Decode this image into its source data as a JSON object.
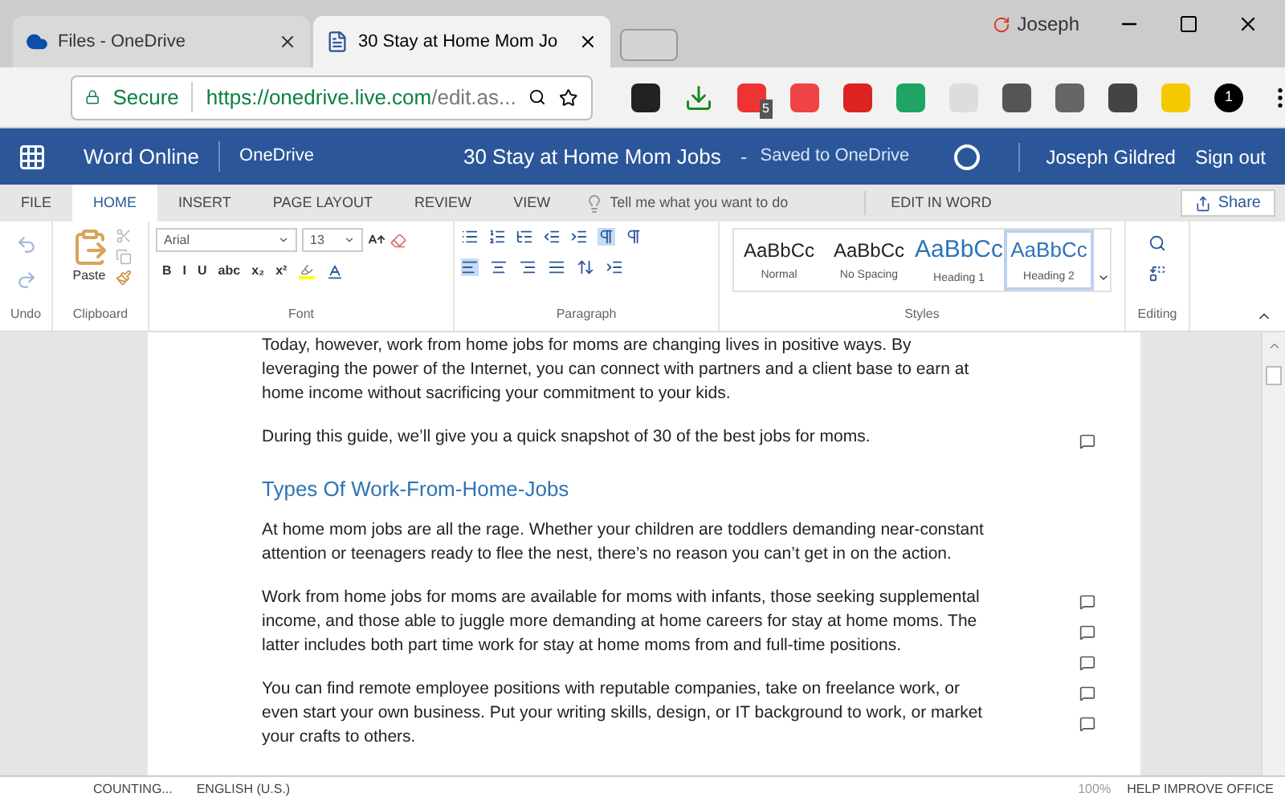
{
  "browser": {
    "profile": "Joseph",
    "tabs": [
      {
        "title": "Files - OneDrive",
        "selected": false
      },
      {
        "title": "30 Stay at Home Mom Jo",
        "selected": true
      }
    ],
    "secure_label": "Secure",
    "url_host": "https://onedrive.live.com",
    "url_path": "/edit.as...",
    "extension_badge": "5",
    "extension_count": "1"
  },
  "app_bar": {
    "app": "Word Online",
    "location": "OneDrive",
    "doc_title": "30 Stay at Home Mom Jobs",
    "separator": "-",
    "save_status": "Saved to OneDrive",
    "user": "Joseph Gildred",
    "sign_out": "Sign out"
  },
  "ribbon_tabs": [
    {
      "label": "FILE",
      "selected": false
    },
    {
      "label": "HOME",
      "selected": true
    },
    {
      "label": "INSERT",
      "selected": false
    },
    {
      "label": "PAGE LAYOUT",
      "selected": false
    },
    {
      "label": "REVIEW",
      "selected": false
    },
    {
      "label": "VIEW",
      "selected": false
    }
  ],
  "tell_me": {
    "placeholder": "Tell me what you want to do"
  },
  "edit_in_word": "EDIT IN WORD",
  "share": "Share",
  "ribbon": {
    "groups": [
      "Undo",
      "Clipboard",
      "Font",
      "Paragraph",
      "Styles",
      "Editing"
    ],
    "paste": "Paste",
    "font": "Arial",
    "size": "13",
    "font_buttons": [
      "B",
      "I",
      "U",
      "abc",
      "x₂",
      "x²"
    ],
    "styles": [
      {
        "sample": "AaBbCc",
        "name": "Normal",
        "kind": "normal",
        "selected": false
      },
      {
        "sample": "AaBbCc",
        "name": "No Spacing",
        "kind": "normal",
        "selected": false
      },
      {
        "sample": "AaBbCc",
        "name": "Heading 1",
        "kind": "heading1",
        "selected": false
      },
      {
        "sample": "AaBbCc",
        "name": "Heading 2",
        "kind": "heading2",
        "selected": true
      }
    ]
  },
  "document": [
    {
      "kind": "paragraph",
      "text": "Today, however, work from home jobs for moms are changing lives in positive ways. By leveraging the power of the Internet, you can connect with partners and a client base to earn at home income without sacrificing your commitment to your kids."
    },
    {
      "kind": "paragraph",
      "text": "During this guide, we’ll give you a quick snapshot of 30 of the best jobs for moms.",
      "comments": [
        {
          "kind": "comment"
        }
      ]
    },
    {
      "kind": "heading",
      "text": "Types Of Work-From-Home-Jobs"
    },
    {
      "kind": "paragraph",
      "text": "At home mom jobs are all the rage. Whether your children are toddlers demanding near-constant attention or teenagers ready to flee the nest, there’s no reason you can’t get in on the action."
    },
    {
      "kind": "paragraph",
      "text": "Work from home jobs for moms are available for moms with infants, those seeking supplemental income, and those able to juggle more demanding at home careers for stay at home moms. The latter includes both part time work for stay at home moms from and full-time positions.",
      "comments": [
        {
          "kind": "comment"
        },
        {
          "kind": "comment"
        },
        {
          "kind": "comment"
        }
      ]
    },
    {
      "kind": "paragraph",
      "text": "You can find remote employee positions with reputable companies, take on freelance work, or even start your own business. Put your writing skills, design, or IT background to work, or market your crafts to others.",
      "comments": [
        {
          "kind": "comment"
        },
        {
          "kind": "comment"
        }
      ]
    }
  ],
  "status_bar": {
    "words": "COUNTING...",
    "language": "ENGLISH (U.S.)",
    "zoom": "100%",
    "help": "HELP IMPROVE OFFICE"
  }
}
